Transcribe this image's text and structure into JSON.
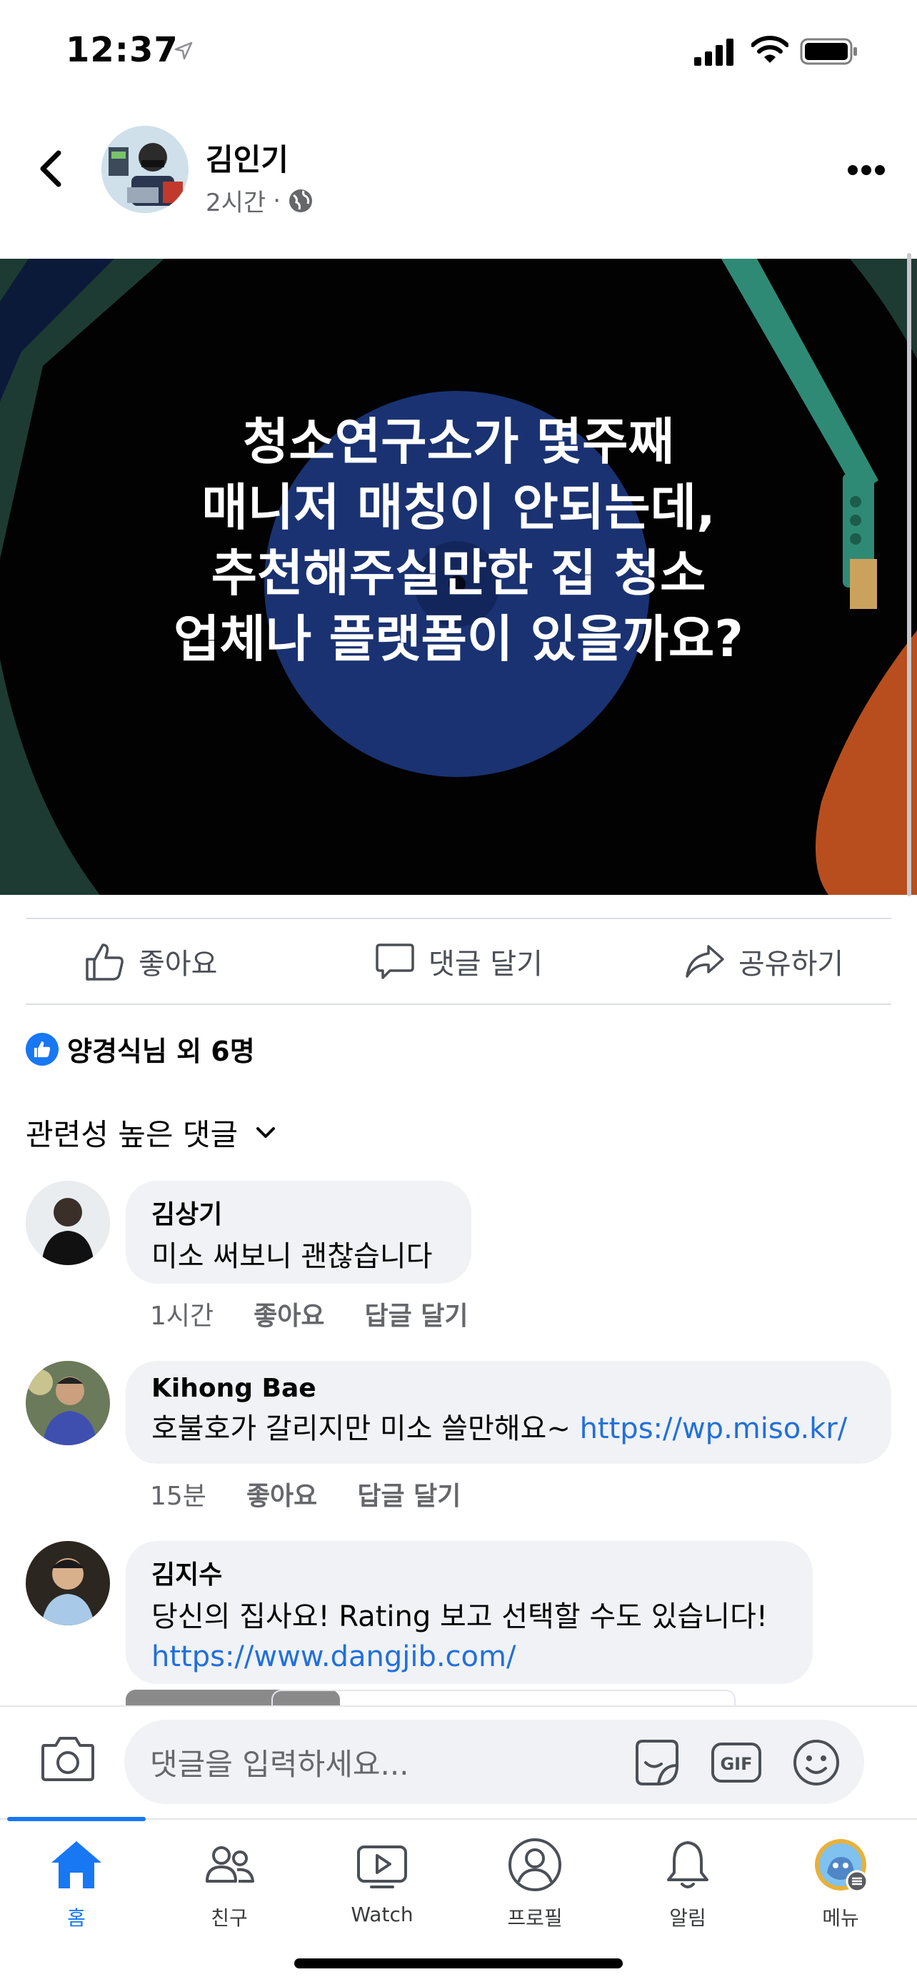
{
  "status_bar": {
    "time": "12:37"
  },
  "post": {
    "author": "김인기",
    "time": "2시간",
    "separator": "·",
    "image_text_lines": [
      "청소연구소가 몇주째",
      "매니저 매칭이 안되는데,",
      "추천해주실만한 집 청소",
      "업체나 플랫폼이 있을까요?"
    ],
    "actions": {
      "like": "좋아요",
      "comment": "댓글 달기",
      "share": "공유하기"
    },
    "reactions": "양경식님 외 6명"
  },
  "comments_sort": "관련성 높은 댓글",
  "comments": [
    {
      "name": "김상기",
      "text": "미소 써보니 괜찮습니다",
      "link": "",
      "time": "1시간",
      "like": "좋아요",
      "reply": "답글 달기"
    },
    {
      "name": "Kihong Bae",
      "text": "호불호가 갈리지만 미소 쓸만해요~ ",
      "link": "https://wp.miso.kr/",
      "time": "15분",
      "like": "좋아요",
      "reply": "답글 달기"
    },
    {
      "name": "김지수",
      "text": "당신의 집사요! Rating 보고 선택할 수도 있습니다!",
      "link": "https://www.dangjib.com/",
      "time": "",
      "like": "",
      "reply": ""
    }
  ],
  "composer": {
    "placeholder": "댓글을 입력하세요...",
    "gif_label": "GIF"
  },
  "tabs": [
    {
      "label": "홈",
      "icon": "home-icon",
      "active": true
    },
    {
      "label": "친구",
      "icon": "friends-icon"
    },
    {
      "label": "Watch",
      "icon": "watch-icon"
    },
    {
      "label": "프로필",
      "icon": "profile-icon"
    },
    {
      "label": "알림",
      "icon": "bell-icon"
    },
    {
      "label": "메뉴",
      "icon": "menu-avatar-icon"
    }
  ],
  "colors": {
    "accent": "#1877f2",
    "link": "#216fdb",
    "bubble": "#f0f2f5",
    "muted": "#65676b"
  }
}
